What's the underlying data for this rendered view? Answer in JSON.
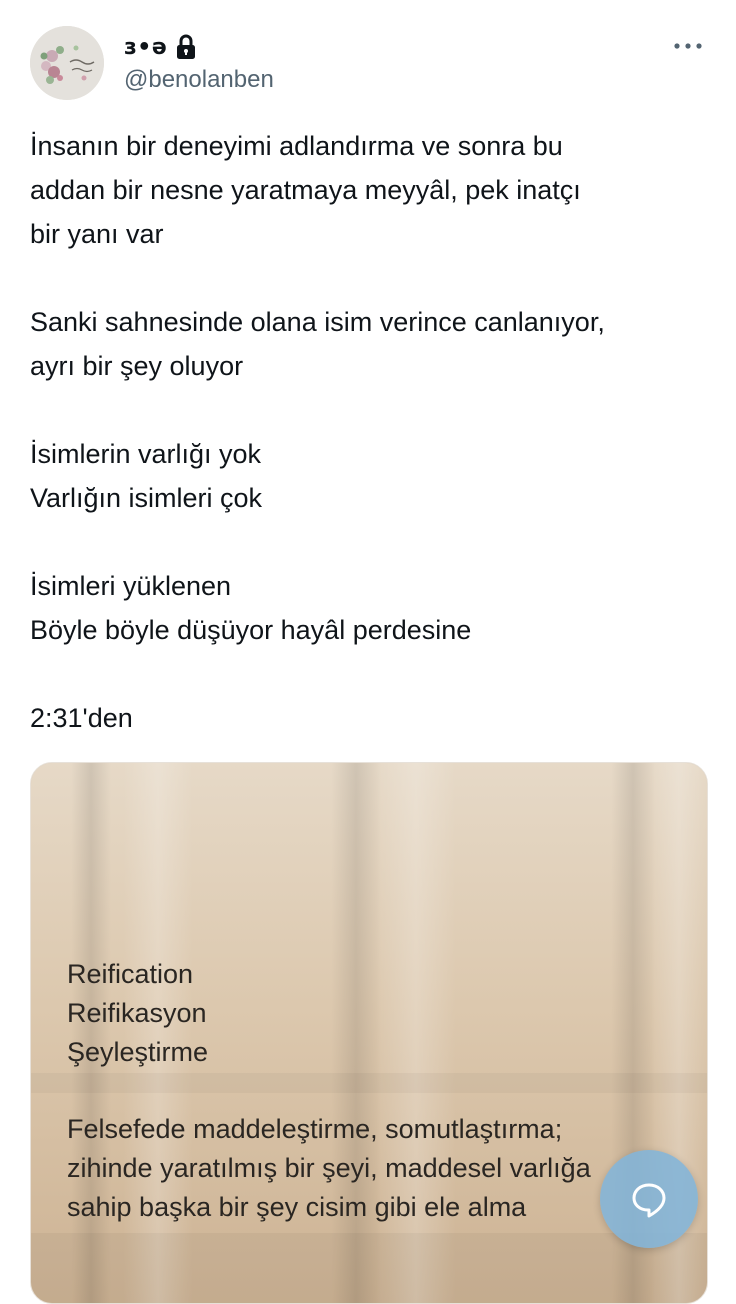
{
  "author": {
    "display_name": "з•ə",
    "handle": "@benolanben",
    "avatar_icon": "floral-wreath-avatar",
    "protected_icon": "lock-icon"
  },
  "more_icon": "more-horizontal-icon",
  "tweet": {
    "lines": [
      "İnsanın bir deneyimi adlandırma ve sonra bu",
      "addan bir nesne yaratmaya meyyâl, pek inatçı",
      "bir yanı var",
      "",
      "Sanki sahnesinde olana isim verince canlanıyor,",
      "ayrı bir şey oluyor",
      "",
      "İsimlerin varlığı yok",
      "Varlığın isimleri çok",
      "",
      "İsimleri yüklenen",
      "Böyle böyle düşüyor hayâl perdesine",
      "",
      "2:31'den"
    ]
  },
  "media": {
    "lines": [
      "Reification",
      "Reifikasyon",
      "Şeyleştirme",
      "",
      "Felsefede maddeleştirme, somutlaştırma;",
      "zihinde yaratılmış bir şeyi, maddesel varlığa",
      "sahip başka bir şey cisim gibi ele alma"
    ],
    "background_color": "#d9c6ae"
  },
  "reply_fab": {
    "icon": "reply-bubble-icon",
    "color": "#82b4d8"
  }
}
